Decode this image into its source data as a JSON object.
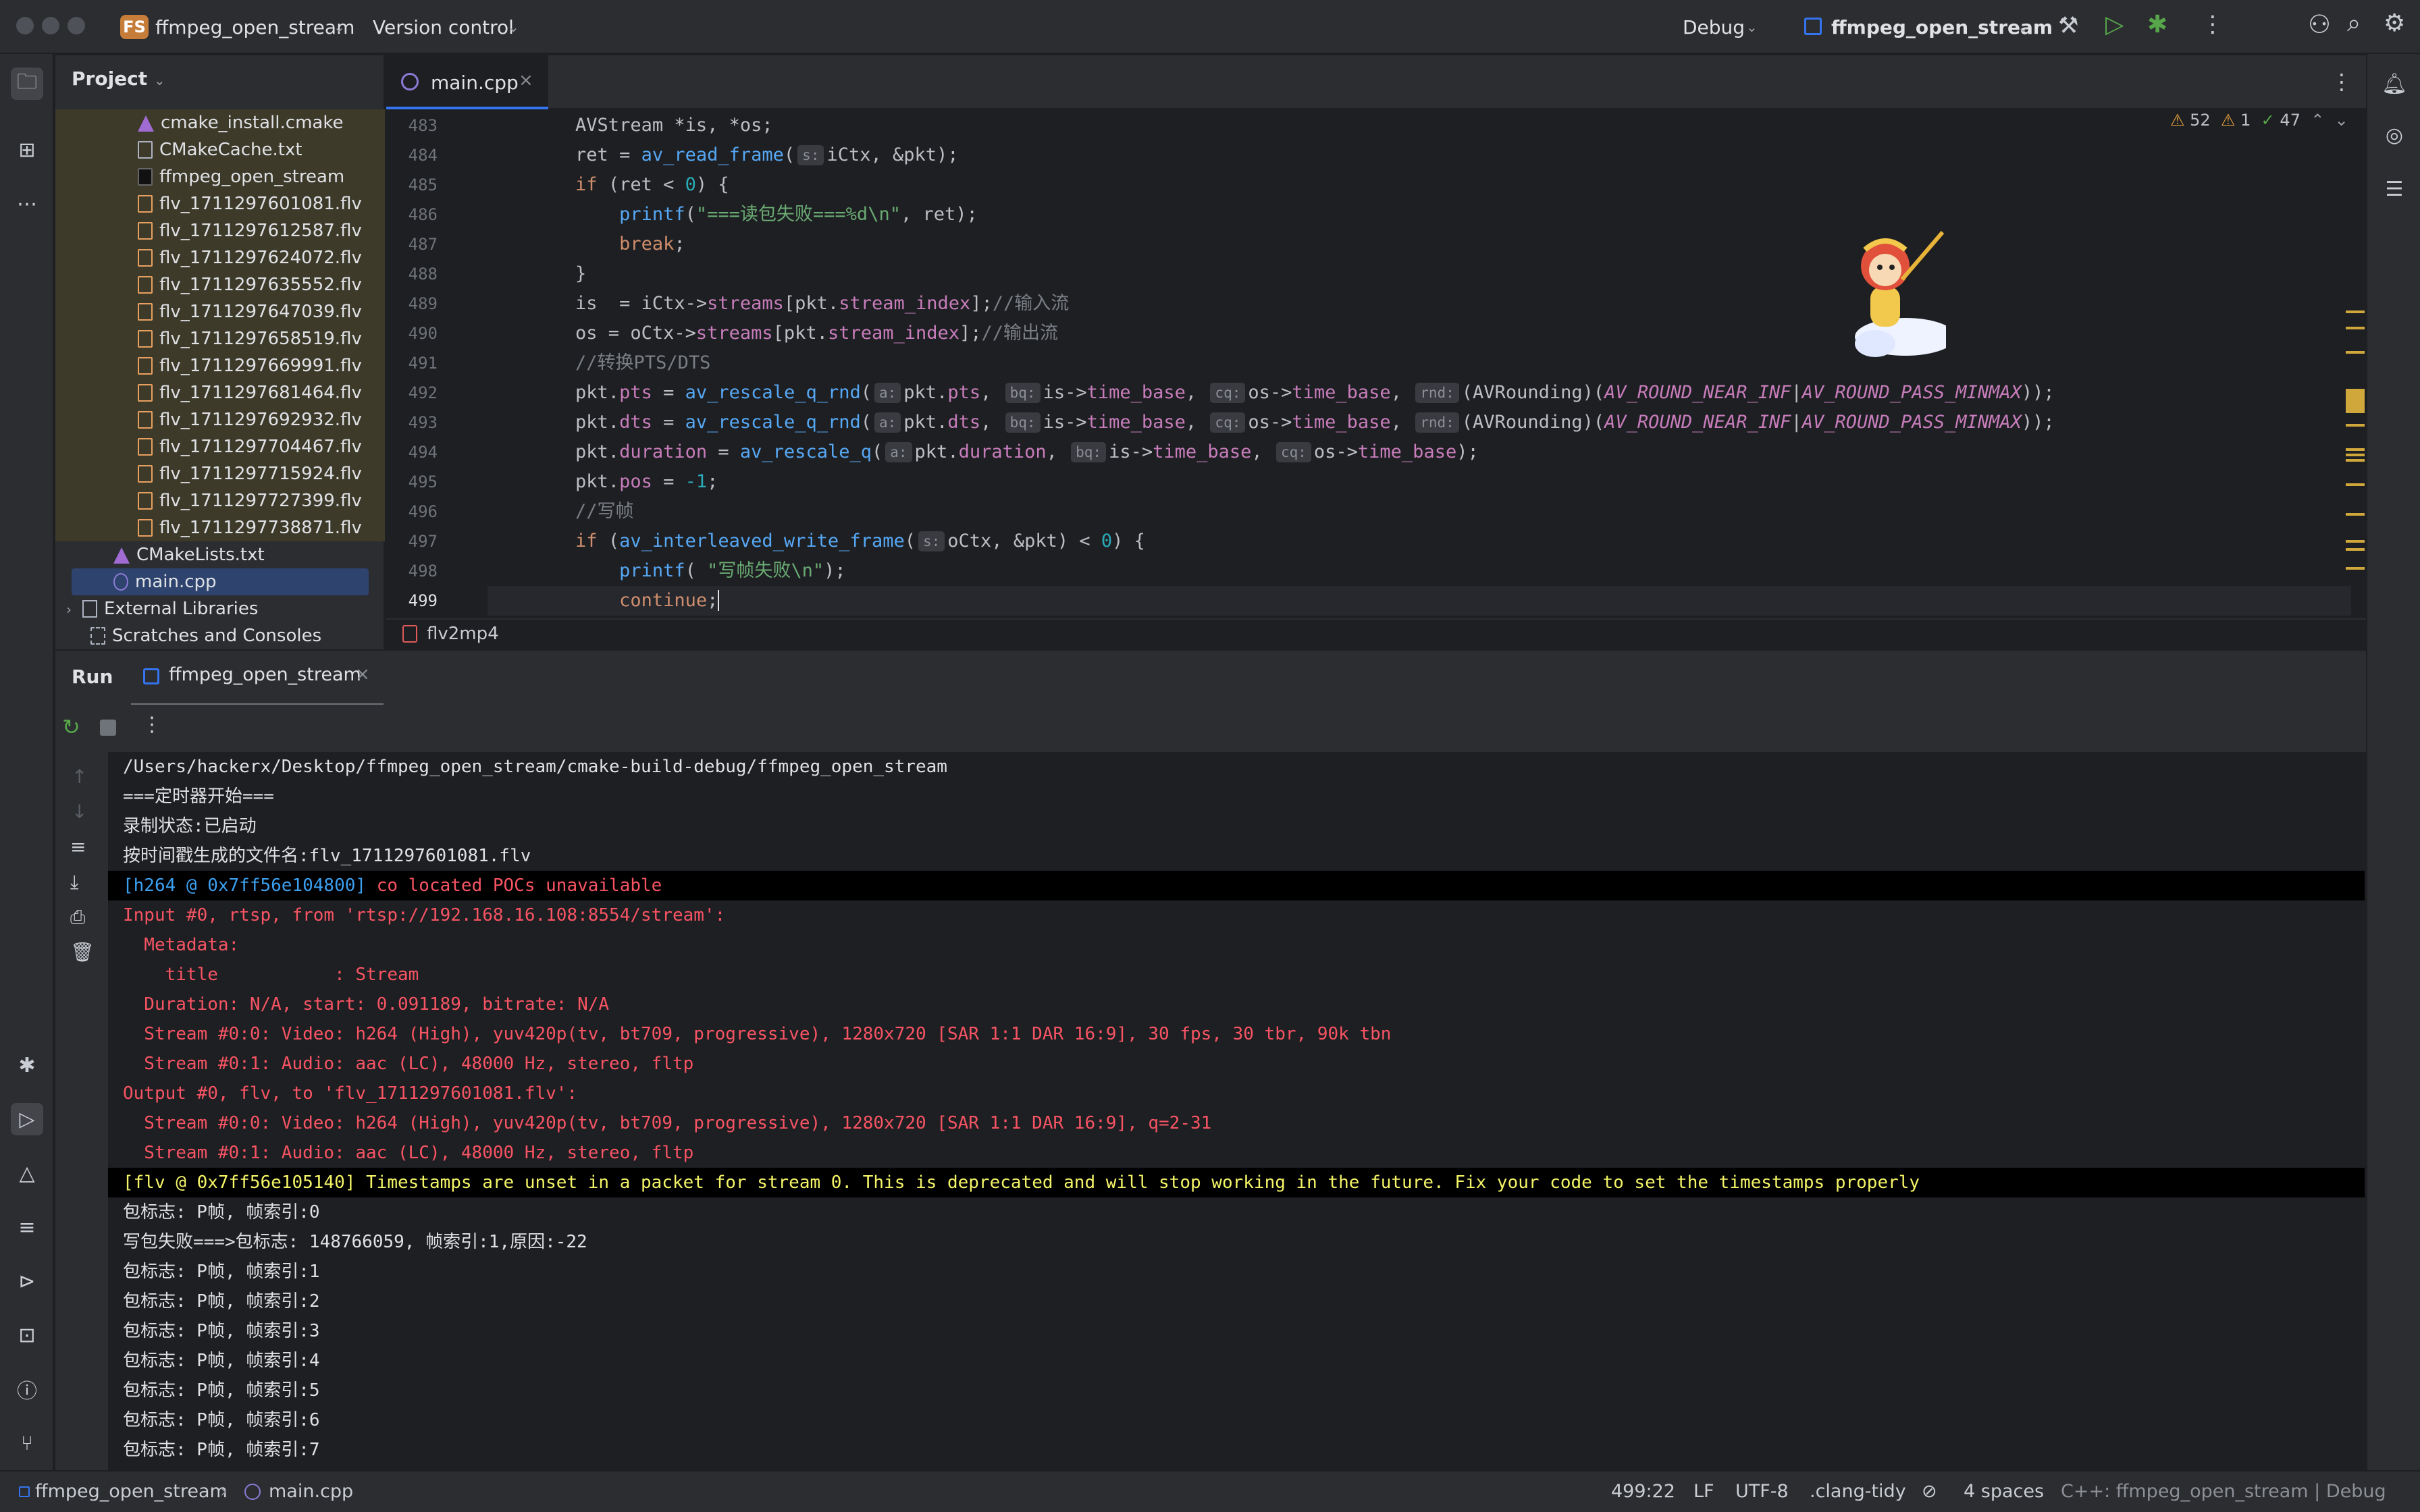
{
  "titlebar": {
    "project_badge": "FS",
    "project_name": "ffmpeg_open_stream",
    "vcs": "Version control",
    "config": "Debug",
    "run_target": "ffmpeg_open_stream"
  },
  "project_panel": {
    "title": "Project",
    "items": [
      {
        "label": "cmake_install.cmake",
        "icon": "cmake-icon"
      },
      {
        "label": "CMakeCache.txt",
        "icon": "text-file-icon"
      },
      {
        "label": "ffmpeg_open_stream",
        "icon": "executable-icon"
      },
      {
        "label": "flv_1711297601081.flv",
        "icon": "flv-file-icon"
      },
      {
        "label": "flv_1711297612587.flv",
        "icon": "flv-file-icon"
      },
      {
        "label": "flv_1711297624072.flv",
        "icon": "flv-file-icon"
      },
      {
        "label": "flv_1711297635552.flv",
        "icon": "flv-file-icon"
      },
      {
        "label": "flv_1711297647039.flv",
        "icon": "flv-file-icon"
      },
      {
        "label": "flv_1711297658519.flv",
        "icon": "flv-file-icon"
      },
      {
        "label": "flv_1711297669991.flv",
        "icon": "flv-file-icon"
      },
      {
        "label": "flv_1711297681464.flv",
        "icon": "flv-file-icon"
      },
      {
        "label": "flv_1711297692932.flv",
        "icon": "flv-file-icon"
      },
      {
        "label": "flv_1711297704467.flv",
        "icon": "flv-file-icon"
      },
      {
        "label": "flv_1711297715924.flv",
        "icon": "flv-file-icon"
      },
      {
        "label": "flv_1711297727399.flv",
        "icon": "flv-file-icon"
      },
      {
        "label": "flv_1711297738871.flv",
        "icon": "flv-file-icon"
      },
      {
        "label": "CMakeLists.txt",
        "icon": "cmake-icon"
      },
      {
        "label": "main.cpp",
        "icon": "cpp-file-icon"
      },
      {
        "label": "External Libraries",
        "icon": "library-icon"
      },
      {
        "label": "Scratches and Consoles",
        "icon": "scratches-icon"
      }
    ]
  },
  "editor": {
    "tab": "main.cpp",
    "inspections": {
      "warnings": "52",
      "weak_warnings": "1",
      "ok": "47"
    },
    "line_numbers": [
      "483",
      "484",
      "485",
      "486",
      "487",
      "488",
      "489",
      "490",
      "491",
      "492",
      "493",
      "494",
      "495",
      "496",
      "497",
      "498",
      "499"
    ],
    "breadcrumb": "flv2mp4"
  },
  "run": {
    "title": "Run",
    "tab": "ffmpeg_open_stream",
    "lines": [
      "/Users/hackerx/Desktop/ffmpeg_open_stream/cmake-build-debug/ffmpeg_open_stream",
      "===定时器开始===",
      "录制状态:已启动",
      "按时间戳生成的文件名:flv_1711297601081.flv",
      "co located POCs unavailable",
      "Input #0, rtsp, from 'rtsp://192.168.16.108:8554/stream':",
      "  Metadata:",
      "    title           : Stream",
      "  Duration: N/A, start: 0.091189, bitrate: N/A",
      "  Stream #0:0: Video: h264 (High), yuv420p(tv, bt709, progressive), 1280x720 [SAR 1:1 DAR 16:9], 30 fps, 30 tbr, 90k tbn",
      "  Stream #0:1: Audio: aac (LC), 48000 Hz, stereo, fltp",
      "Output #0, flv, to 'flv_1711297601081.flv':",
      "  Stream #0:0: Video: h264 (High), yuv420p(tv, bt709, progressive), 1280x720 [SAR 1:1 DAR 16:9], q=2-31",
      "  Stream #0:1: Audio: aac (LC), 48000 Hz, stereo, fltp",
      "Timestamps are unset in a packet for stream 0. This is deprecated and will stop working in the future. Fix your code to set the timestamps properly",
      "包标志: P帧, 帧索引:0",
      "写包失败===>包标志: 148766059, 帧索引:1,原因:-22",
      "包标志: P帧, 帧索引:1",
      "包标志: P帧, 帧索引:2",
      "包标志: P帧, 帧索引:3",
      "包标志: P帧, 帧索引:4",
      "包标志: P帧, 帧索引:5",
      "包标志: P帧, 帧索引:6",
      "包标志: P帧, 帧索引:7"
    ],
    "prefix_h264": "[h264 @ 0x7ff56e104800]",
    "prefix_flv": "[flv @ 0x7ff56e105140]"
  },
  "statusbar": {
    "project": "ffmpeg_open_stream",
    "file": "main.cpp",
    "position": "499:22",
    "line_sep": "LF",
    "encoding": "UTF-8",
    "linter": ".clang-tidy",
    "indent": "4 spaces",
    "context": "C++: ffmpeg_open_stream | Debug"
  },
  "colors": {
    "accent": "#3574f0",
    "error_text": "#f75464",
    "warning_text": "#f4f468",
    "project_badge": "#c77d3a"
  }
}
